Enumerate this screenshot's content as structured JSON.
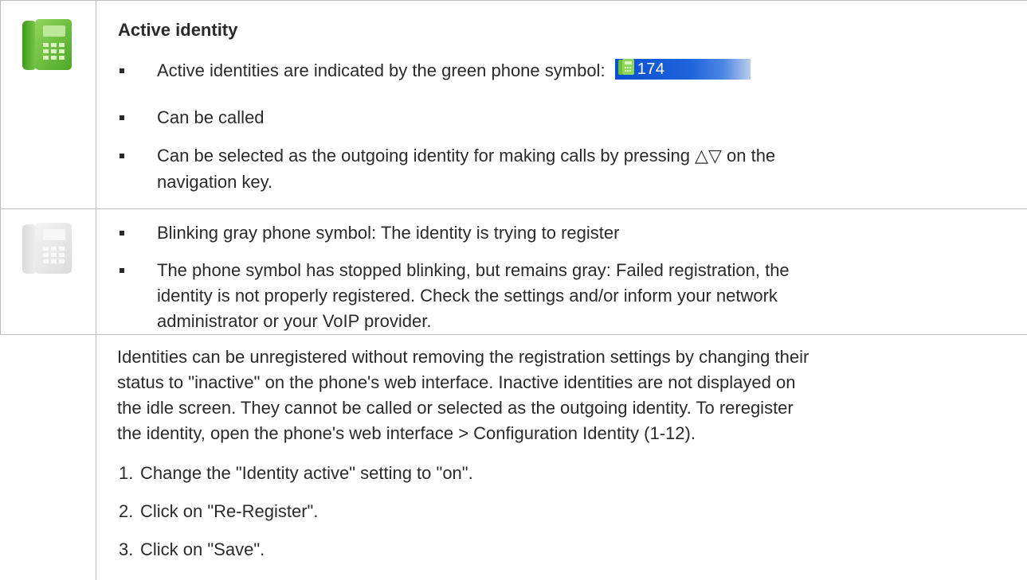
{
  "row1": {
    "heading": "Active identity",
    "bullet1_text": "Active identities are indicated by the green phone symbol:",
    "badge_number": "174",
    "bullet2_text": "Can be called",
    "bullet3_line1": "Can be selected as the outgoing identity for making calls by pressing △▽ on the",
    "bullet3_line2": "navigation key."
  },
  "row2": {
    "bullet1_text": "Blinking gray phone symbol:  The identity is trying to register",
    "bullet2_line1": "The phone symbol has stopped blinking, but remains gray:  Failed registration, the",
    "bullet2_line2": "identity is not properly registered.  Check the settings and/or inform your network",
    "bullet2_line3": "administrator or your VoIP provider."
  },
  "row3": {
    "para_line1": "Identities can be unregistered without removing the registration settings by changing their",
    "para_line2": "status to \"inactive\" on the phone's web interface.  Inactive identities are not displayed on",
    "para_line3": "the idle screen.  They cannot be called or selected as the outgoing identity.  To reregister",
    "para_line4": "the identity, open the phone's web interface  >  Configuration Identity (1-12).",
    "steps": [
      {
        "num": "1.",
        "text": "Change the \"Identity active\" setting to \"on\"."
      },
      {
        "num": "2.",
        "text": "Click on \"Re-Register\"."
      },
      {
        "num": "3.",
        "text": "Click on \"Save\"."
      }
    ]
  },
  "colors": {
    "border": "#bdbdbd",
    "green_icon": "#5fb833",
    "gray_icon": "#e3e3e3",
    "badge_blue": "#0a4fd1"
  },
  "icons": {
    "active_phone": "green-phone-icon",
    "inactive_phone": "gray-phone-icon"
  }
}
